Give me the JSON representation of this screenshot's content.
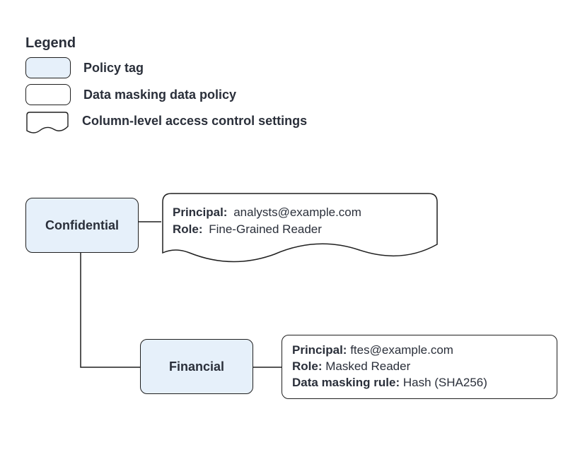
{
  "legend": {
    "title": "Legend",
    "items": [
      {
        "label": "Policy tag"
      },
      {
        "label": "Data masking data policy"
      },
      {
        "label": "Column-level access control settings"
      }
    ]
  },
  "nodes": {
    "confidential": {
      "label": "Confidential",
      "settings": {
        "principal_key": "Principal:",
        "principal_val": "analysts@example.com",
        "role_key": "Role:",
        "role_val": "Fine-Grained Reader"
      }
    },
    "financial": {
      "label": "Financial",
      "policy": {
        "principal_key": "Principal:",
        "principal_val": "ftes@example.com",
        "role_key": "Role:",
        "role_val": "Masked Reader",
        "rule_key": "Data masking rule:",
        "rule_val": "Hash (SHA256)"
      }
    }
  }
}
